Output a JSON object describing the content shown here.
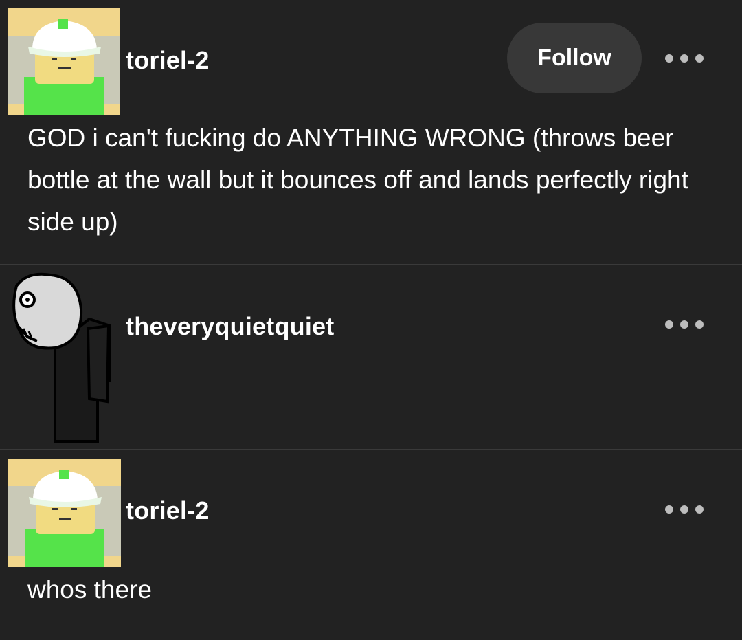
{
  "posts": [
    {
      "username": "toriel-2",
      "follow_label": "Follow",
      "text": "GOD i can't fucking do ANYTHING WRONG (throws beer bottle at the wall but it bounces off and lands perfectly right side up)"
    },
    {
      "username": "theveryquietquiet",
      "text": ""
    },
    {
      "username": "toriel-2",
      "text": "whos there"
    }
  ],
  "icons": {
    "more": "ellipsis-icon",
    "avatar_1": "roblox-avatar-icon",
    "avatar_2": "drawn-figure-avatar-icon"
  },
  "colors": {
    "background": "#222222",
    "text": "#ffffff",
    "follow_button": "#383838",
    "divider": "#3a3a3a"
  }
}
